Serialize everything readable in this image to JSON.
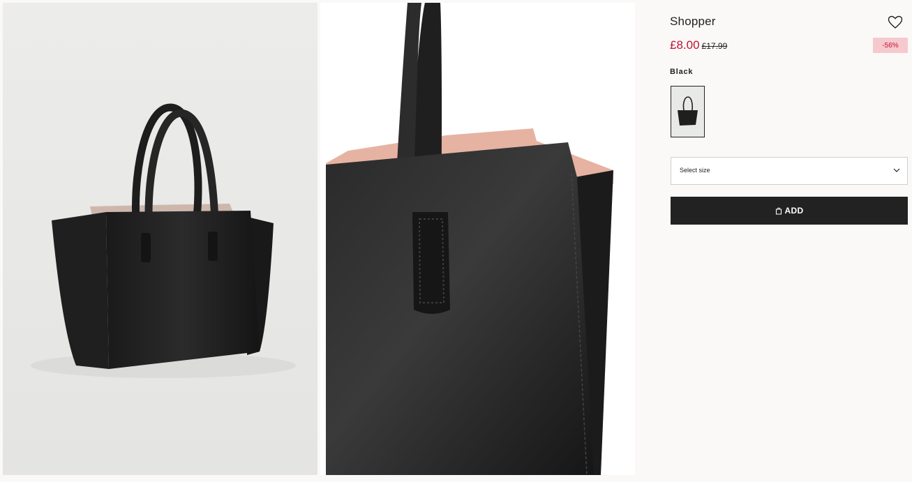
{
  "gallery": {
    "images": [
      {
        "name": "product-image-main",
        "subject": "black shopper bag, full view"
      },
      {
        "name": "product-image-detail",
        "subject": "black shopper bag, handle close-up"
      }
    ]
  },
  "product": {
    "title": "Shopper",
    "price_now": "£8.00",
    "price_was": "£17.99",
    "discount": "-56%",
    "color_name": "Black",
    "size_placeholder": "Select size",
    "add_label": "ADD"
  },
  "icons": {
    "wishlist": "heart-icon",
    "size_dropdown": "chevron-down-icon",
    "add_button": "shopping-bag-icon"
  },
  "colors": {
    "sale_price": "#c41130",
    "discount_badge_bg": "#f5c9ce",
    "add_button_bg": "#222222",
    "page_bg": "#faf9f8"
  }
}
